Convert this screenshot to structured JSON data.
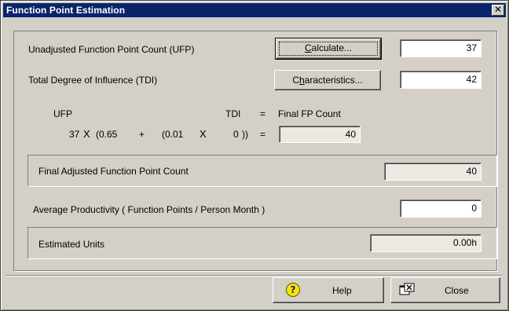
{
  "window": {
    "title": "Function Point Estimation",
    "close_glyph": "✕"
  },
  "ufp": {
    "label": "Unadjusted Function Point Count (UFP)",
    "button": "Calculate...",
    "button_accel": "C",
    "button_rest": "alculate...",
    "value": "37"
  },
  "tdi": {
    "label": "Total Degree of Influence (TDI)",
    "button": "Characteristics...",
    "button_pre": "C",
    "button_accel": "h",
    "button_rest": "aracteristics...",
    "value": "42"
  },
  "formula": {
    "hdr_ufp": "UFP",
    "hdr_tdi": "TDI",
    "hdr_eq": "=",
    "hdr_final": "Final FP Count",
    "ufp_val": "37",
    "times1": "X",
    "open1": "(0.65",
    "plus": "+",
    "open2": "(0.01",
    "times2": "X",
    "tdi_val": "0",
    "close": "))",
    "eq": "=",
    "result": "40"
  },
  "final_adjusted": {
    "label": "Final Adjusted Function Point Count",
    "value": "40"
  },
  "productivity": {
    "label": "Average Productivity ( Function Points / Person Month )",
    "value": "0"
  },
  "estimated": {
    "label": "Estimated Units",
    "value": "0.00h"
  },
  "footer": {
    "help_label": "Help",
    "close_label": "Close",
    "help_icon": "help-icon",
    "close_icon": "close-window-icon"
  }
}
